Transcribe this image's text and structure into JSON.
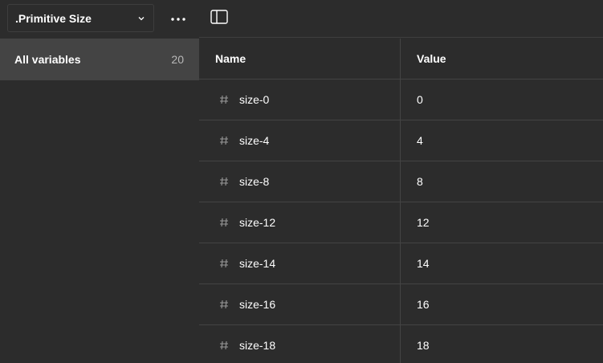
{
  "collection": {
    "name": ".Primitive Size"
  },
  "groups": [
    {
      "label": "All variables",
      "count": "20"
    }
  ],
  "table": {
    "headers": {
      "name": "Name",
      "value": "Value"
    },
    "rows": [
      {
        "name": "size-0",
        "value": "0"
      },
      {
        "name": "size-4",
        "value": "4"
      },
      {
        "name": "size-8",
        "value": "8"
      },
      {
        "name": "size-12",
        "value": "12"
      },
      {
        "name": "size-14",
        "value": "14"
      },
      {
        "name": "size-16",
        "value": "16"
      },
      {
        "name": "size-18",
        "value": "18"
      }
    ]
  },
  "icons": {
    "collection_chevron": "chevron-down-icon",
    "more": "more-horizontal-icon",
    "panel_toggle": "sidebar-panel-icon",
    "variable_type": "hash-icon"
  },
  "colors": {
    "background": "#2c2c2c",
    "selected_group": "#444444",
    "border": "#444444",
    "text": "#ffffff",
    "muted_text": "#b8b8b8"
  }
}
